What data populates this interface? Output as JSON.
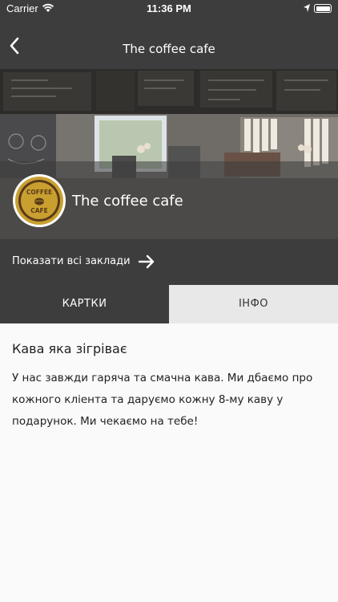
{
  "status_bar": {
    "carrier": "Carrier",
    "time": "11:36 PM"
  },
  "nav": {
    "title": "The coffee cafe",
    "back_icon": "chevron-left-icon"
  },
  "hero": {
    "shop_name": "The coffee cafe",
    "logo_top": "COFFEE",
    "logo_bottom": "CAFE"
  },
  "show_all": {
    "label": "Показати всі заклади",
    "arrow_icon": "arrow-right-icon"
  },
  "tabs": [
    {
      "label": "КАРТКИ",
      "active": false
    },
    {
      "label": "ІНФО",
      "active": true
    }
  ],
  "info": {
    "heading": "Кава яка зігріває",
    "body": "У нас завжди гаряча та смачна кава. Ми дбаємо про кожного кліента та даруємо кожну 8-му каву у подарунок. Ми чекаємо на тебе!"
  },
  "colors": {
    "dark": "#3d3d3d",
    "tab_inactive": "#e8e8e8",
    "logo_gold": "#c9a030",
    "logo_brown": "#5a3a1a"
  }
}
